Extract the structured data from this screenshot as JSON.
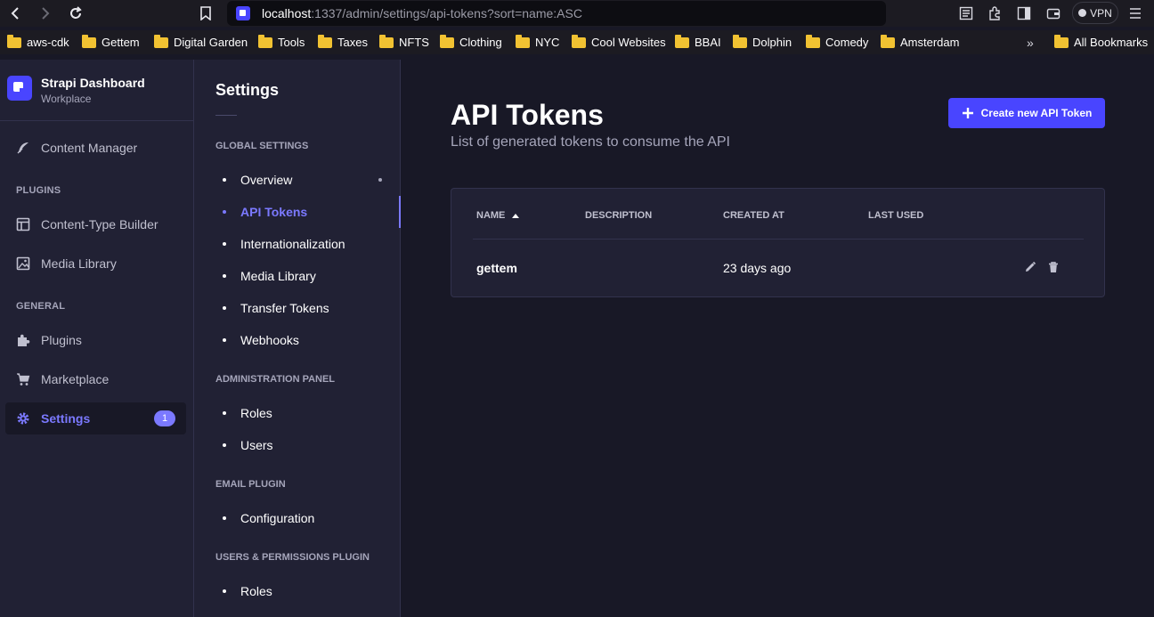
{
  "browser": {
    "url_host": "localhost",
    "url_rest": ":1337/admin/settings/api-tokens?sort=name:ASC",
    "vpn_label": "VPN",
    "bookmarks": [
      "aws-cdk",
      "Gettem",
      "Digital Garden",
      "Tools",
      "Taxes",
      "NFTS",
      "Clothing",
      "NYC",
      "Cool Websites",
      "BBAI",
      "Dolphin",
      "Comedy",
      "Amsterdam"
    ],
    "more_label": "»",
    "all_bookmarks": "All Bookmarks"
  },
  "mainnav": {
    "brand_title": "Strapi Dashboard",
    "brand_sub": "Workplace",
    "content_manager": "Content Manager",
    "plugins_section": "PLUGINS",
    "content_type_builder": "Content-Type Builder",
    "media_library": "Media Library",
    "general_section": "GENERAL",
    "plugins": "Plugins",
    "marketplace": "Marketplace",
    "settings": "Settings",
    "settings_badge": "1"
  },
  "subnav": {
    "title": "Settings",
    "global_section": "GLOBAL SETTINGS",
    "overview": "Overview",
    "api_tokens": "API Tokens",
    "internationalization": "Internationalization",
    "media_library": "Media Library",
    "transfer_tokens": "Transfer Tokens",
    "webhooks": "Webhooks",
    "admin_section": "ADMINISTRATION PANEL",
    "roles": "Roles",
    "users": "Users",
    "email_section": "EMAIL PLUGIN",
    "configuration": "Configuration",
    "up_section": "USERS & PERMISSIONS PLUGIN",
    "up_roles": "Roles"
  },
  "main": {
    "title": "API Tokens",
    "subtitle": "List of generated tokens to consume the API",
    "create_button": "Create new API Token",
    "table": {
      "headers": [
        "NAME",
        "DESCRIPTION",
        "CREATED AT",
        "LAST USED"
      ],
      "rows": [
        {
          "name": "gettem",
          "description": "",
          "created_at": "23 days ago",
          "last_used": ""
        }
      ]
    }
  }
}
